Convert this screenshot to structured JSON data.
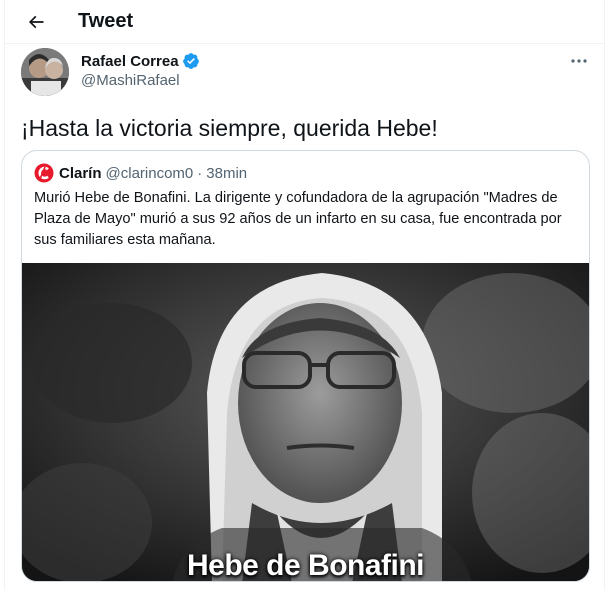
{
  "header": {
    "title": "Tweet",
    "back_icon": "arrow-left-icon"
  },
  "author": {
    "name": "Rafael Correa",
    "handle": "@MashiRafael",
    "verified": true,
    "verified_color": "#1d9bf0"
  },
  "tweet": {
    "text": "¡Hasta la victoria siempre, querida Hebe!"
  },
  "quote": {
    "name": "Clarín",
    "handle": "@clarincom0",
    "separator": "·",
    "time": "38min",
    "logo_color": "#e8192c",
    "text": "Murió Hebe de Bonafini. La dirigente y cofundadora de la agrupación \"Madres de Plaza de Mayo\" murió a sus 92 años de un infarto en su casa, fue encontrada por sus familiares esta mañana.",
    "image_caption": "Hebe de Bonafini"
  },
  "colors": {
    "text_primary": "#0f1419",
    "text_secondary": "#536471",
    "border": "#cfd9de"
  }
}
